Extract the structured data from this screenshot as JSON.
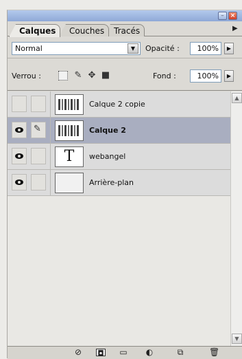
{
  "tabs": [
    {
      "label": "Calques",
      "active": true
    },
    {
      "label": "Couches",
      "active": false
    },
    {
      "label": "Tracés",
      "active": false
    }
  ],
  "blend": {
    "mode": "Normal",
    "opacity_label": "Opacité :",
    "opacity_value": "100%"
  },
  "lock": {
    "label": "Verrou :",
    "fill_label": "Fond :",
    "fill_value": "100%"
  },
  "layers": [
    {
      "name": "Calque 2 copie",
      "visible": false,
      "linked": false,
      "thumb": "image",
      "selected": false
    },
    {
      "name": "Calque 2",
      "visible": true,
      "linked": true,
      "thumb": "image",
      "selected": true
    },
    {
      "name": "webangel",
      "visible": true,
      "linked": false,
      "thumb": "text",
      "thumb_text": "T",
      "selected": false
    },
    {
      "name": "Arrière-plan",
      "visible": true,
      "linked": false,
      "thumb": "blank",
      "selected": false
    }
  ],
  "icons": {
    "palette_menu": "chevron-right-icon",
    "window_min": "minimize-icon",
    "window_close": "close-icon"
  },
  "colors": {
    "title_bar": "#9fb7e0",
    "selected_layer": "#a9aec0",
    "panel_bg": "#dcdad5"
  }
}
